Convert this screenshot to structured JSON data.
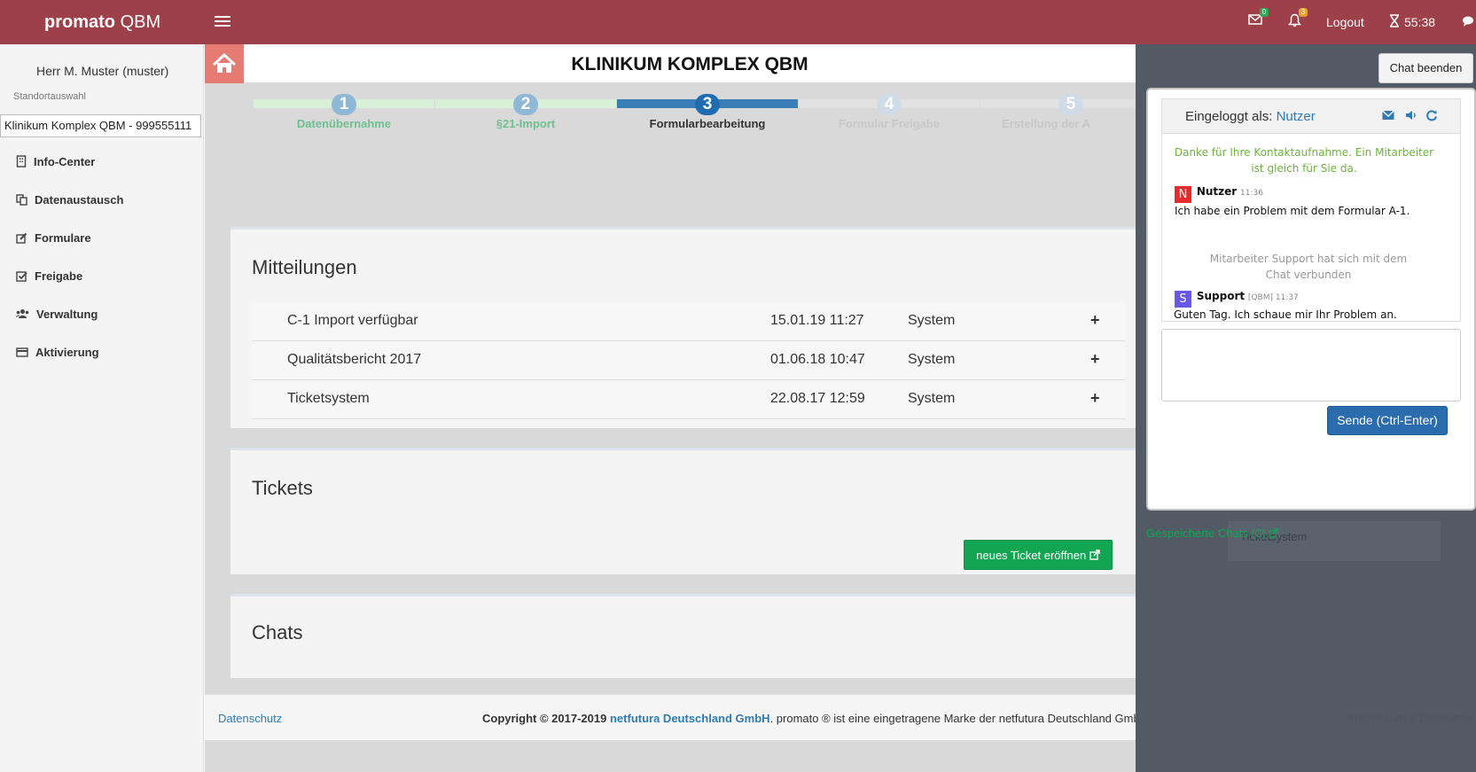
{
  "header": {
    "brand_bold": "promato",
    "brand_rest": "QBM",
    "mail_count": "0",
    "notification_count": "3",
    "logout_label": "Logout",
    "timer": "55:38",
    "color": "#9e4049"
  },
  "sidebar": {
    "user": "Herr M. Muster (muster)",
    "location_label": "Standortauswahl",
    "location_value": "Klinikum Komplex QBM - 999555111",
    "items": [
      {
        "label": "Info-Center",
        "icon": "building-icon"
      },
      {
        "label": "Datenaustausch",
        "icon": "copy-icon"
      },
      {
        "label": "Formulare",
        "icon": "edit-icon"
      },
      {
        "label": "Freigabe",
        "icon": "check-square-icon"
      },
      {
        "label": "Verwaltung",
        "icon": "users-icon"
      },
      {
        "label": "Aktivierung",
        "icon": "credit-card-icon"
      }
    ]
  },
  "main": {
    "title": "KLINIKUM KOMPLEX QBM",
    "wizard": [
      {
        "num": "1",
        "label": "Datenübernahme",
        "state": "done"
      },
      {
        "num": "2",
        "label": "§21-Import",
        "state": "done"
      },
      {
        "num": "3",
        "label": "Formularbearbeitung",
        "state": "active"
      },
      {
        "num": "4",
        "label": "Formular Freigabe",
        "state": "todo"
      },
      {
        "num": "5",
        "label": "Erstellung der A",
        "state": "todo"
      }
    ],
    "messages_title": "Mitteilungen",
    "messages": [
      {
        "title": "C-1 Import verfügbar",
        "date": "15.01.19 11:27",
        "source": "System"
      },
      {
        "title": "Qualitätsbericht 2017",
        "date": "01.06.18 10:47",
        "source": "System"
      },
      {
        "title": "Ticketsystem",
        "date": "22.08.17 12:59",
        "source": "System"
      }
    ],
    "tickets_title": "Tickets",
    "new_ticket_label": "neues Ticket eröffnen",
    "chats_title": "Chats"
  },
  "footer": {
    "privacy": "Datenschutz",
    "copyright_prefix": "Copyright © 2017-2019",
    "company": "netfutura Deutschland GmbH",
    "copyright_suffix": ". promato ® ist eine eingetragene Marke der netfutura Deutschland GmbH.",
    "imprint": "Impressum & Disclaimer"
  },
  "chat": {
    "end_label": "Chat beenden",
    "logged_in_prefix": "Eingeloggt als:",
    "logged_in_user": "Nutzer",
    "greeting": "Danke für Ihre Kontaktaufnahme. Ein Mitarbeiter ist gleich für Sie da.",
    "messages": [
      {
        "avatar": "N",
        "sender": "Nutzer",
        "meta": "11:36",
        "text": "Ich habe ein Problem mit dem Formular A-1."
      },
      {
        "avatar": "S",
        "sender": "Support",
        "meta": "[QBM] 11:37",
        "text": "Guten Tag. Ich schaue mir Ihr Problem an."
      }
    ],
    "joined_notice": "Mitarbeiter Support hat sich mit dem Chat verbunden",
    "input_value": "",
    "send_label": "Sende (Ctrl-Enter)",
    "saved_chats": "Gespeicherte Chats (0)",
    "ghost_system": "Ticketsystem"
  }
}
